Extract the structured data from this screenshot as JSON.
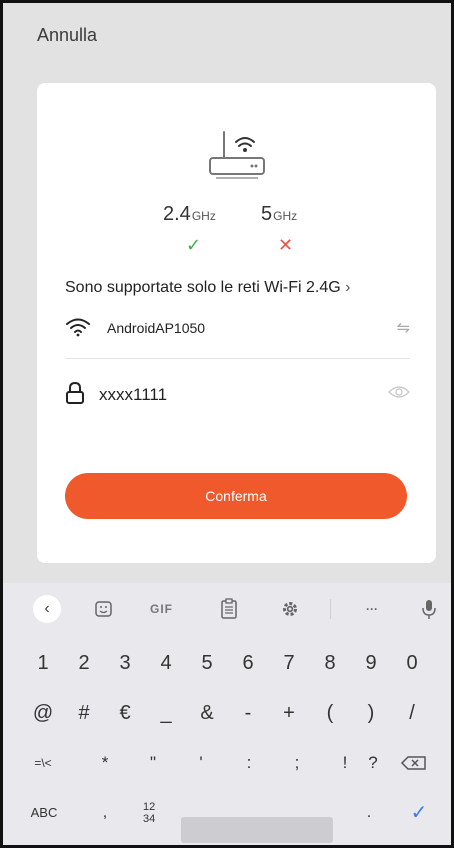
{
  "header": {
    "cancel_label": "Annulla"
  },
  "frequencies": {
    "band_24": {
      "value": "2.4",
      "unit": "GHz",
      "status": "supported"
    },
    "band_5": {
      "value": "5",
      "unit": "GHz",
      "status": "unsupported"
    }
  },
  "notice": {
    "text": "Sono supportate solo le reti Wi-Fi 2.4G",
    "chevron": "›"
  },
  "network": {
    "ssid": "AndroidAP1050",
    "icon": "wifi-icon"
  },
  "password": {
    "value": "xxxx1111",
    "icon": "lock-icon"
  },
  "confirm_label": "Conferma",
  "colors": {
    "accent": "#f0592b",
    "supported": "#3fae49",
    "unsupported": "#e8564b",
    "keyboard_confirm": "#3b7ee9"
  },
  "keyboard": {
    "toolbar": {
      "gif_label": "GIF",
      "more_label": "···"
    },
    "row1": [
      "1",
      "2",
      "3",
      "4",
      "5",
      "6",
      "7",
      "8",
      "9",
      "0"
    ],
    "row2": [
      "@",
      "#",
      "€",
      "_",
      "&",
      "-",
      "+",
      "(",
      ")",
      "/"
    ],
    "row3": [
      "=\\<",
      "*",
      "\"",
      "'",
      ":",
      ";",
      "!",
      "?"
    ],
    "row4": {
      "abc_label": "ABC",
      "comma": ",",
      "fraction_top": "12",
      "fraction_bottom": "34",
      "period": "."
    }
  }
}
